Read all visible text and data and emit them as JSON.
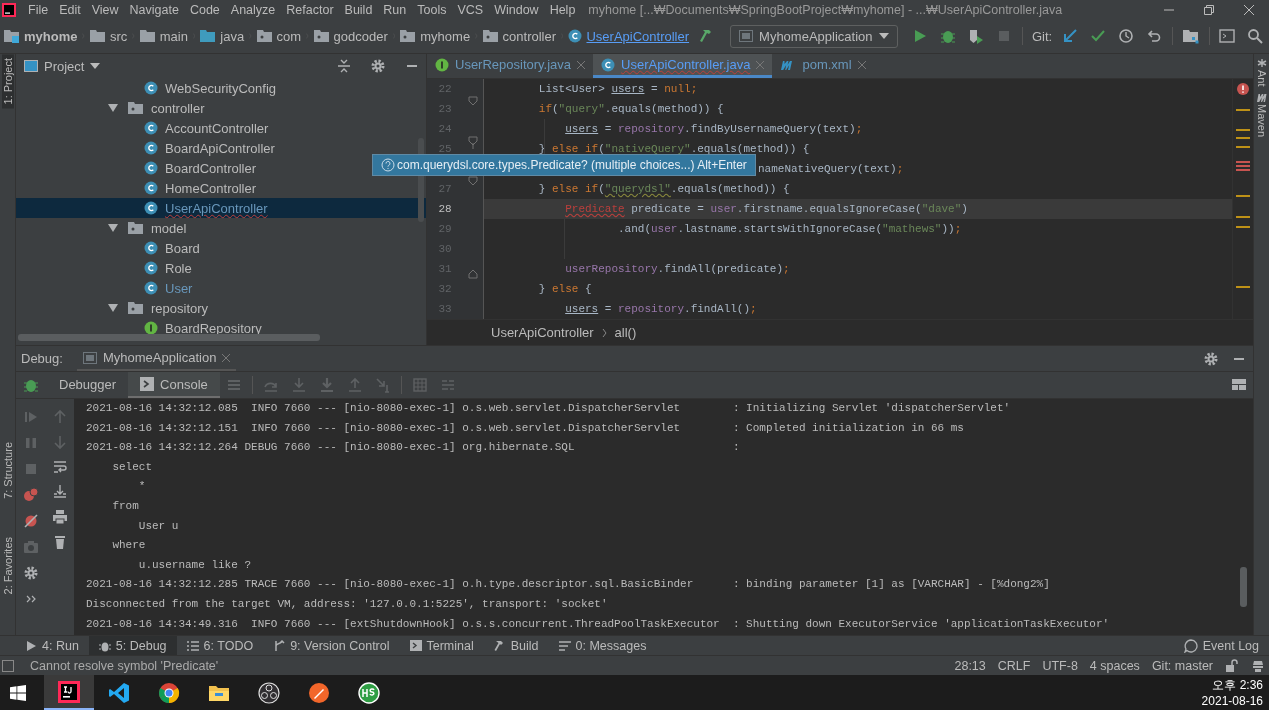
{
  "window": {
    "title": "myhome [...₩Documents₩SpringBootProject₩myhome] - ...₩UserApiController.java"
  },
  "menu": [
    "File",
    "Edit",
    "View",
    "Navigate",
    "Code",
    "Analyze",
    "Refactor",
    "Build",
    "Run",
    "Tools",
    "VCS",
    "Window",
    "Help"
  ],
  "breadcrumbs": [
    {
      "label": "myhome",
      "kind": "module"
    },
    {
      "label": "src",
      "kind": "folder"
    },
    {
      "label": "main",
      "kind": "folder"
    },
    {
      "label": "java",
      "kind": "source"
    },
    {
      "label": "com",
      "kind": "package"
    },
    {
      "label": "godcoder",
      "kind": "package"
    },
    {
      "label": "myhome",
      "kind": "package"
    },
    {
      "label": "controller",
      "kind": "package"
    },
    {
      "label": "UserApiController",
      "kind": "class"
    }
  ],
  "run_config": "MyhomeApplication",
  "git_label": "Git:",
  "side_tabs_left": [
    {
      "label": "1: Project",
      "selected": true
    },
    {
      "label": "7: Structure",
      "selected": false
    },
    {
      "label": "2: Favorites",
      "selected": false
    }
  ],
  "side_tabs_right": [
    "Ant",
    "Maven"
  ],
  "project_panel": {
    "title": "Project",
    "tree": [
      {
        "label": "WebSecurityConfig",
        "kind": "class",
        "selected": false,
        "modified": false
      },
      {
        "label": "controller",
        "kind": "package",
        "expanded": true,
        "selected": false,
        "children": [
          {
            "label": "AccountController",
            "kind": "class",
            "selected": false,
            "modified": false
          },
          {
            "label": "BoardApiController",
            "kind": "class",
            "selected": false,
            "modified": false
          },
          {
            "label": "BoardController",
            "kind": "class",
            "selected": false,
            "modified": false
          },
          {
            "label": "HomeController",
            "kind": "class",
            "selected": false,
            "modified": false
          },
          {
            "label": "UserApiController",
            "kind": "class",
            "selected": true,
            "modified": true
          }
        ]
      },
      {
        "label": "model",
        "kind": "package",
        "expanded": true,
        "selected": false,
        "children": [
          {
            "label": "Board",
            "kind": "class",
            "selected": false,
            "modified": false
          },
          {
            "label": "Role",
            "kind": "class",
            "selected": false,
            "modified": false
          },
          {
            "label": "User",
            "kind": "class",
            "selected": false,
            "modified": true
          }
        ]
      },
      {
        "label": "repository",
        "kind": "package",
        "expanded": true,
        "selected": false,
        "children": [
          {
            "label": "BoardRepository",
            "kind": "interface",
            "selected": false,
            "modified": false
          }
        ]
      }
    ]
  },
  "editor_tabs": [
    {
      "label": "UserRepository.java",
      "kind": "interface",
      "selected": false
    },
    {
      "label": "UserApiController.java",
      "kind": "class",
      "selected": true
    },
    {
      "label": "pom.xml",
      "kind": "maven",
      "selected": false
    }
  ],
  "code": [
    {
      "number": "22",
      "current": false,
      "tokens": [
        {
          "text": "List<User> ",
          "kind": "plain"
        },
        {
          "text": "users",
          "kind": "var"
        },
        {
          "text": " = ",
          "kind": "plain"
        },
        {
          "text": "null;",
          "kind": "kw"
        }
      ]
    },
    {
      "number": "23",
      "current": false,
      "tokens": [
        {
          "text": "if",
          "kind": "kw"
        },
        {
          "text": "(",
          "kind": "plain"
        },
        {
          "text": "\"query\"",
          "kind": "str"
        },
        {
          "text": ".equals(method)) {",
          "kind": "plain"
        }
      ],
      "children": [
        {
          "number": "24",
          "current": false,
          "tokens": [
            {
              "text": "users",
              "kind": "var"
            },
            {
              "text": " = ",
              "kind": "plain"
            },
            {
              "text": "repository",
              "kind": "field"
            },
            {
              "text": ".findByUsernameQuery(text)",
              "kind": "plain"
            },
            {
              "text": ";",
              "kind": "kw"
            }
          ]
        }
      ]
    },
    {
      "number": "25",
      "current": false,
      "tokens": [
        {
          "text": "} ",
          "kind": "plain"
        },
        {
          "text": "else if",
          "kind": "kw"
        },
        {
          "text": "(",
          "kind": "plain"
        },
        {
          "text": "\"nativeQuery\"",
          "kind": "str"
        },
        {
          "text": ".equals(method)) {",
          "kind": "plain"
        }
      ],
      "children": [
        {
          "current": false,
          "covered_start": true,
          "tokens": [
            {
              "text": "nameNativeQuery(text)",
              "kind": "plain"
            },
            {
              "text": ";",
              "kind": "kw"
            }
          ]
        }
      ]
    },
    {
      "number": "27",
      "current": false,
      "tokens": [
        {
          "text": "} ",
          "kind": "plain"
        },
        {
          "text": "else if",
          "kind": "kw"
        },
        {
          "text": "(",
          "kind": "plain"
        },
        {
          "text": "\"querydsl\"",
          "kind": "warn"
        },
        {
          "text": ".equals(method)) {",
          "kind": "plain"
        }
      ],
      "children": [
        {
          "number": "28",
          "current": true,
          "tokens": [
            {
              "text": "Predicate",
              "kind": "error"
            },
            {
              "text": " predicate = ",
              "kind": "plain"
            },
            {
              "text": "user",
              "kind": "field"
            },
            {
              "text": ".firstname.equalsIgnoreCase(",
              "kind": "plain"
            },
            {
              "text": "\"dave\"",
              "kind": "str"
            },
            {
              "text": ")",
              "kind": "plain"
            }
          ],
          "children": [
            {
              "number": "29",
              "current": false,
              "tokens": [
                {
                  "text": ".and(",
                  "kind": "plain"
                },
                {
                  "text": "user",
                  "kind": "field"
                },
                {
                  "text": ".lastname.startsWithIgnoreCase(",
                  "kind": "plain"
                },
                {
                  "text": "\"mathews\"",
                  "kind": "str"
                },
                {
                  "text": "))",
                  "kind": "plain"
                },
                {
                  "text": ";",
                  "kind": "kw"
                }
              ]
            }
          ]
        },
        {
          "number": "30",
          "current": false
        },
        {
          "number": "31",
          "current": false,
          "tokens": [
            {
              "text": "userRepository",
              "kind": "field"
            },
            {
              "text": ".findAll(predicate)",
              "kind": "plain"
            },
            {
              "text": ";",
              "kind": "kw"
            }
          ]
        }
      ]
    },
    {
      "number": "32",
      "current": false,
      "tokens": [
        {
          "text": "} ",
          "kind": "plain"
        },
        {
          "text": "else",
          "kind": "kw"
        },
        {
          "text": " {",
          "kind": "plain"
        }
      ],
      "children": [
        {
          "number": "33",
          "current": false,
          "tokens": [
            {
              "text": "users",
              "kind": "var"
            },
            {
              "text": " = ",
              "kind": "plain"
            },
            {
              "text": "repository",
              "kind": "field"
            },
            {
              "text": ".findAll()",
              "kind": "plain"
            },
            {
              "text": ";",
              "kind": "kw"
            }
          ]
        }
      ]
    }
  ],
  "tooltip": "com.querydsl.core.types.Predicate? (multiple choices...) Alt+Enter",
  "editor_breadcrumbs": [
    "UserApiController",
    "all()"
  ],
  "debug": {
    "label": "Debug:",
    "session": "MyhomeApplication",
    "tabs": [
      {
        "label": "Debugger",
        "selected": false
      },
      {
        "label": "Console",
        "selected": true
      }
    ],
    "console": [
      "2021-08-16 14:32:12.085  INFO 7660 --- [nio-8080-exec-1] o.s.web.servlet.DispatcherServlet        : Initializing Servlet 'dispatcherServlet'",
      "2021-08-16 14:32:12.151  INFO 7660 --- [nio-8080-exec-1] o.s.web.servlet.DispatcherServlet        : Completed initialization in 66 ms",
      "2021-08-16 14:32:12.264 DEBUG 7660 --- [nio-8080-exec-1] org.hibernate.SQL                        :",
      "    select",
      "        *",
      "    from",
      "        User u",
      "    where",
      "        u.username like ?",
      "2021-08-16 14:32:12.285 TRACE 7660 --- [nio-8080-exec-1] o.h.type.descriptor.sql.BasicBinder      : binding parameter [1] as [VARCHAR] - [%dong2%]",
      "Disconnected from the target VM, address: '127.0.0.1:5225', transport: 'socket'",
      "2021-08-16 14:34:49.316  INFO 7660 --- [extShutdownHook] o.s.s.concurrent.ThreadPoolTaskExecutor  : Shutting down ExecutorService 'applicationTaskExecutor'"
    ]
  },
  "tool_tabs": [
    {
      "label": "4: Run",
      "kind": "run",
      "selected": false
    },
    {
      "label": "5: Debug",
      "kind": "debug",
      "selected": true
    },
    {
      "label": "6: TODO",
      "kind": "todo",
      "selected": false
    },
    {
      "label": "9: Version Control",
      "kind": "vcs",
      "selected": false
    },
    {
      "label": "Terminal",
      "kind": "terminal",
      "selected": false
    },
    {
      "label": "Build",
      "kind": "build",
      "selected": false
    },
    {
      "label": "0: Messages",
      "kind": "messages",
      "selected": false
    }
  ],
  "event_log": "Event Log",
  "status_bar": {
    "message": "Cannot resolve symbol 'Predicate'",
    "items": [
      "28:13",
      "CRLF",
      "UTF-8",
      "4 spaces",
      "Git: master"
    ]
  },
  "taskbar": {
    "apps": [
      {
        "kind": "intellij",
        "selected": true
      },
      {
        "kind": "vscode",
        "selected": false
      },
      {
        "kind": "chrome",
        "selected": false
      },
      {
        "kind": "explorer",
        "selected": false
      },
      {
        "kind": "obs",
        "selected": false
      },
      {
        "kind": "paw",
        "selected": false
      },
      {
        "kind": "hs",
        "selected": false
      }
    ],
    "time": "오후 2:36",
    "date": "2021-08-16"
  }
}
